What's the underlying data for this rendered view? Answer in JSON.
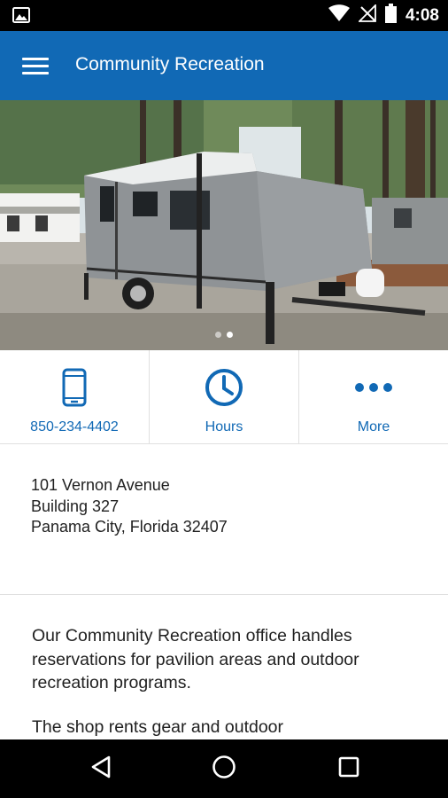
{
  "status_bar": {
    "time": "4:08",
    "icons": [
      "image-icon",
      "wifi-icon",
      "no-signal-icon",
      "battery-icon"
    ]
  },
  "app_bar": {
    "title": "Community Recreation",
    "menu_icon": "hamburger-menu-icon"
  },
  "hero": {
    "image_description_icon": "photo-travel-trailer",
    "carousel": {
      "count": 2,
      "active_index": 1
    }
  },
  "actions": [
    {
      "label": "850-234-4402",
      "icon": "phone-icon"
    },
    {
      "label": "Hours",
      "icon": "clock-icon"
    },
    {
      "label": "More",
      "icon": "more-dots-icon"
    }
  ],
  "address": {
    "line1": "101 Vernon Avenue",
    "line2": "Building 327",
    "line3": "Panama City, Florida 32407"
  },
  "description": {
    "paragraph1": "Our Community Recreation office handles reservations for pavilion areas and outdoor recreation programs.",
    "paragraph2": "The shop rents gear and outdoor"
  },
  "nav_bar": {
    "buttons": [
      "back-icon",
      "home-icon",
      "recents-icon"
    ]
  },
  "colors": {
    "primary": "#1169b5",
    "status_bar": "#000000",
    "text": "#212121",
    "divider": "#e0e0e0"
  }
}
